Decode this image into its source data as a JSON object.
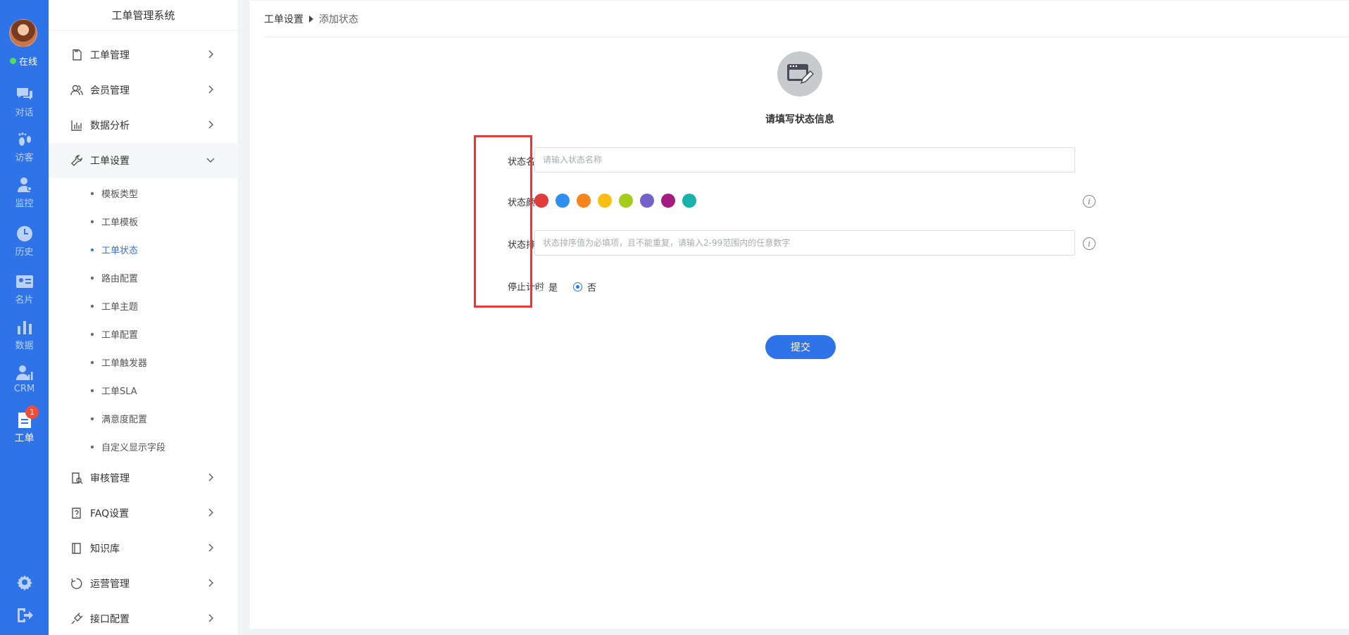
{
  "rail": {
    "status": "在线",
    "items": [
      {
        "label": "对话",
        "icon": "chat-icon"
      },
      {
        "label": "访客",
        "icon": "footprint-icon"
      },
      {
        "label": "监控",
        "icon": "monitor-user-icon"
      },
      {
        "label": "历史",
        "icon": "clock-icon"
      },
      {
        "label": "名片",
        "icon": "card-icon"
      },
      {
        "label": "数据",
        "icon": "bar-chart-icon"
      },
      {
        "label": "CRM",
        "icon": "crm-icon"
      },
      {
        "label": "工单",
        "icon": "ticket-icon",
        "badge": "1"
      }
    ],
    "bottom": [
      {
        "icon": "gear-icon"
      },
      {
        "icon": "logout-icon"
      }
    ],
    "colors": {
      "bg": "#2f73e8",
      "badge": "#f04c3a",
      "online": "#4ee05a"
    }
  },
  "menu": {
    "title": "工单管理系统",
    "items": [
      {
        "label": "工单管理",
        "icon": "ticket-doc-icon"
      },
      {
        "label": "会员管理",
        "icon": "members-icon"
      },
      {
        "label": "数据分析",
        "icon": "chart-icon"
      },
      {
        "label": "工单设置",
        "icon": "wrench-icon"
      },
      {
        "label": "审核管理",
        "icon": "audit-icon"
      },
      {
        "label": "FAQ设置",
        "icon": "faq-icon"
      },
      {
        "label": "知识库",
        "icon": "book-icon"
      },
      {
        "label": "运营管理",
        "icon": "operation-icon"
      },
      {
        "label": "接口配置",
        "icon": "plug-icon"
      }
    ],
    "sub_items": [
      "模板类型",
      "工单模板",
      "工单状态",
      "路由配置",
      "工单主题",
      "工单配置",
      "工单触发器",
      "工单SLA",
      "满意度配置",
      "自定义显示字段"
    ],
    "active_sub": "工单状态"
  },
  "breadcrumb": {
    "parent": "工单设置",
    "current": "添加状态"
  },
  "form": {
    "heading": "请填写状态信息",
    "name_label": "状态名称",
    "name_placeholder": "请输入状态名称",
    "color_label": "状态颜色",
    "colors": [
      "#e23b3b",
      "#2f8ff0",
      "#f7841c",
      "#fbbf14",
      "#a4cd1b",
      "#7461c9",
      "#a51b82",
      "#17b3aa"
    ],
    "sort_label": "状态排序",
    "sort_placeholder": "状态排序值为必填项，且不能重复，请输入2-99范围内的任意数字",
    "stop_label": "停止计时",
    "stop_options": [
      "是",
      "否"
    ],
    "stop_selected": "否",
    "submit": "提交",
    "info_glyph": "i"
  }
}
